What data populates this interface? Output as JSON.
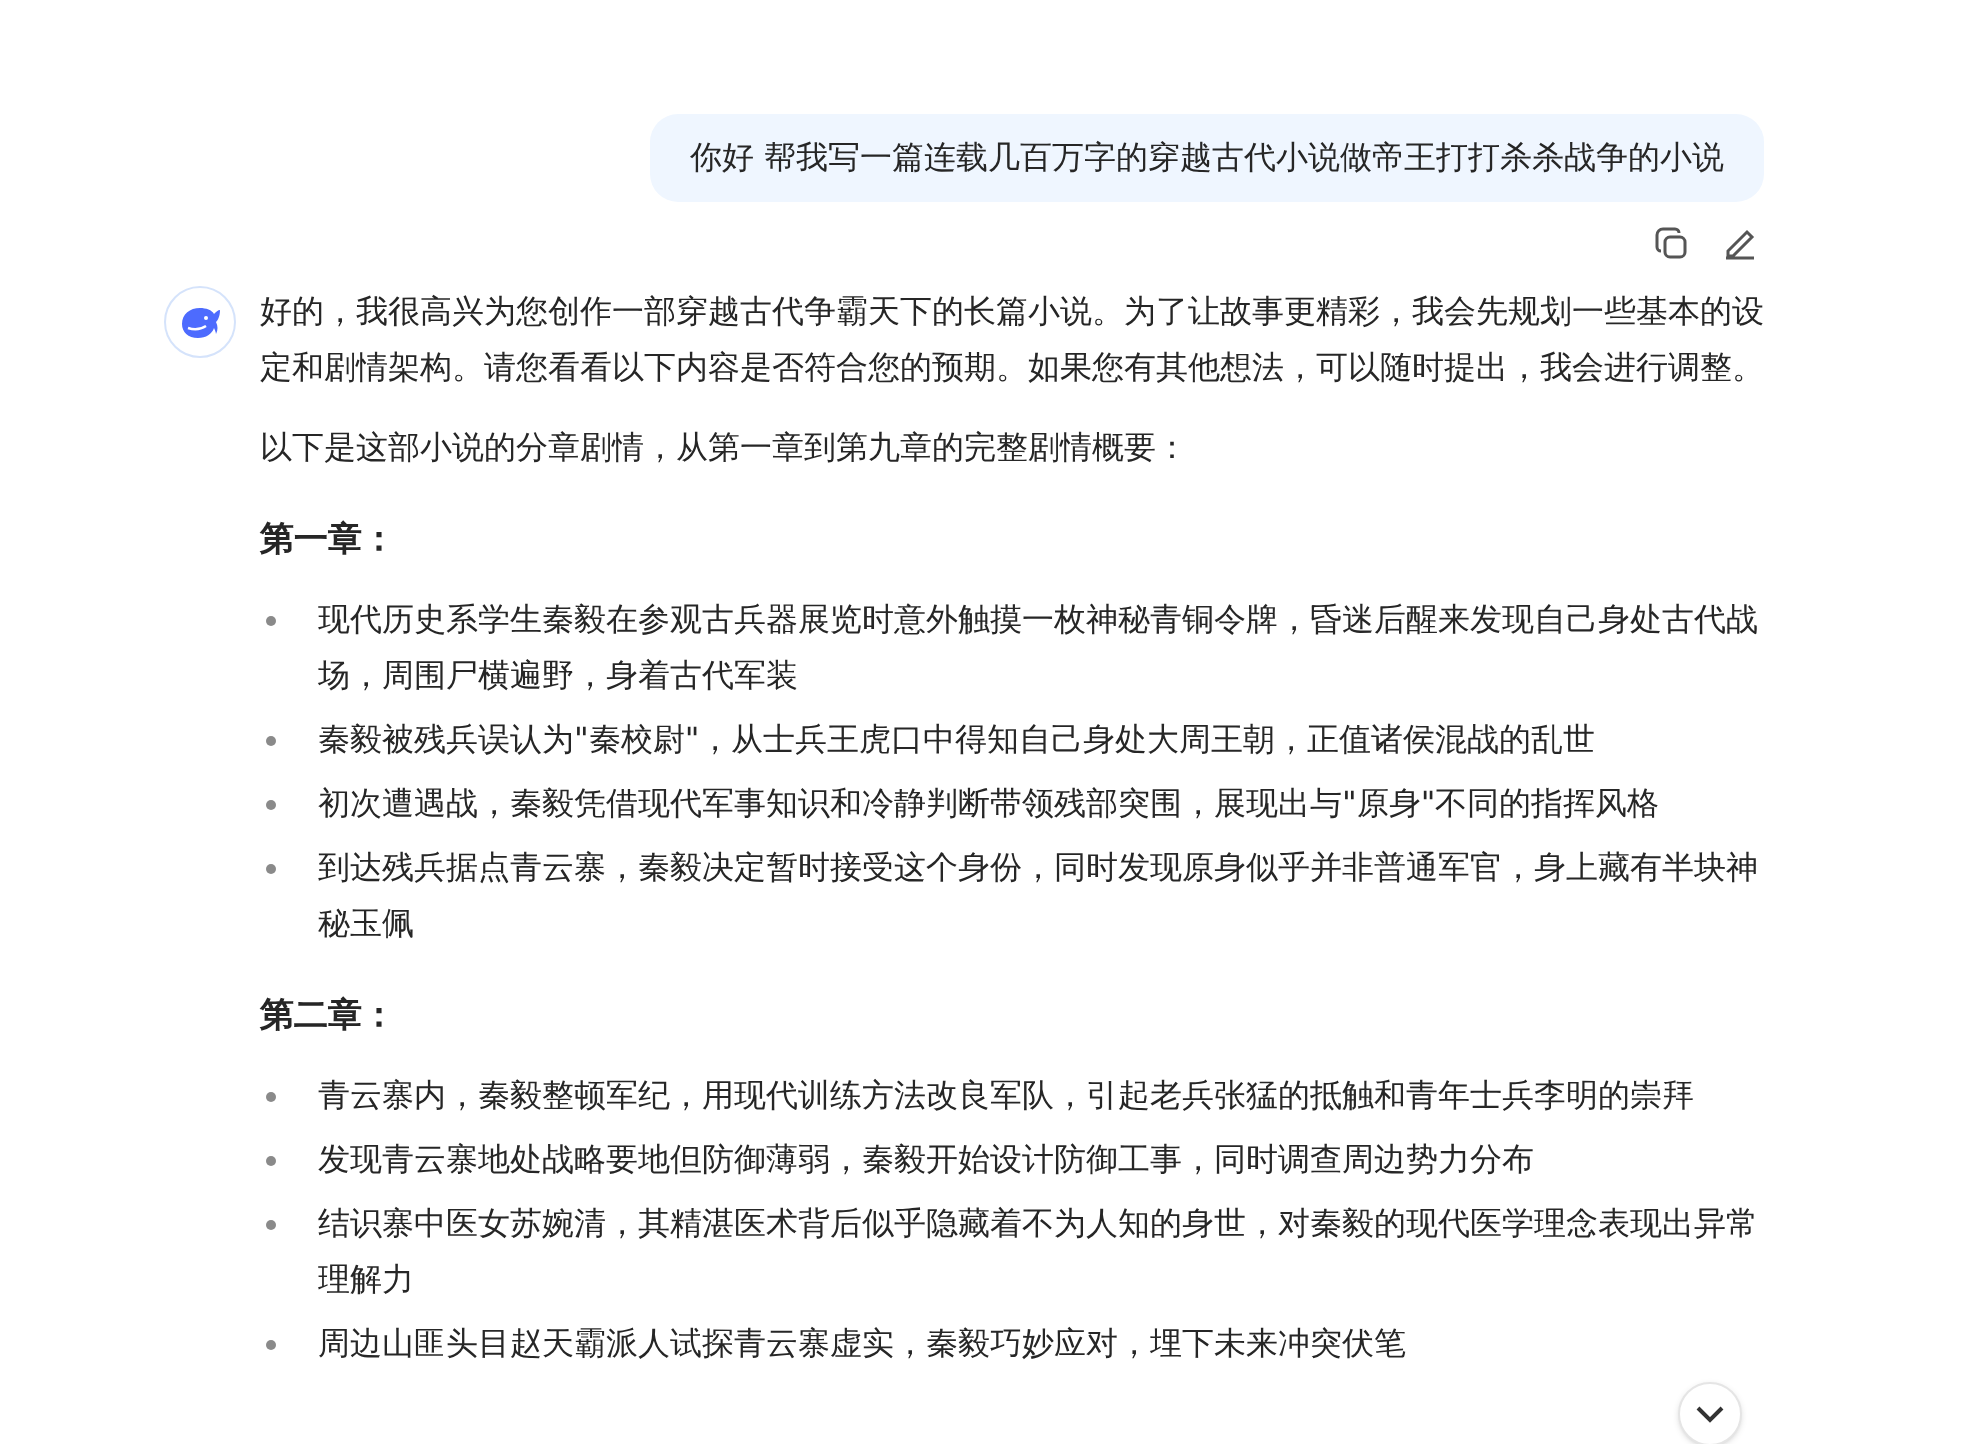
{
  "user_message": {
    "text": "你好 帮我写一篇连载几百万字的穿越古代小说做帝王打打杀杀战争的小说"
  },
  "reply": {
    "intro": [
      "好的，我很高兴为您创作一部穿越古代争霸天下的长篇小说。为了让故事更精彩，我会先规划一些基本的设定和剧情架构。请您看看以下内容是否符合您的预期。如果您有其他想法，可以随时提出，我会进行调整。",
      "以下是这部小说的分章剧情，从第一章到第九章的完整剧情概要："
    ],
    "chapters": [
      {
        "heading": "第一章：",
        "items": [
          "现代历史系学生秦毅在参观古兵器展览时意外触摸一枚神秘青铜令牌，昏迷后醒来发现自己身处古代战场，周围尸横遍野，身着古代军装",
          "秦毅被残兵误认为\"秦校尉\"，从士兵王虎口中得知自己身处大周王朝，正值诸侯混战的乱世",
          "初次遭遇战，秦毅凭借现代军事知识和冷静判断带领残部突围，展现出与\"原身\"不同的指挥风格",
          "到达残兵据点青云寨，秦毅决定暂时接受这个身份，同时发现原身似乎并非普通军官，身上藏有半块神秘玉佩"
        ]
      },
      {
        "heading": "第二章：",
        "items": [
          "青云寨内，秦毅整顿军纪，用现代训练方法改良军队，引起老兵张猛的抵触和青年士兵李明的崇拜",
          "发现青云寨地处战略要地但防御薄弱，秦毅开始设计防御工事，同时调查周边势力分布",
          "结识寨中医女苏婉清，其精湛医术背后似乎隐藏着不为人知的身世，对秦毅的现代医学理念表现出异常理解力",
          "周边山匪头目赵天霸派人试探青云寨虚实，秦毅巧妙应对，埋下未来冲突伏笔"
        ]
      }
    ]
  }
}
